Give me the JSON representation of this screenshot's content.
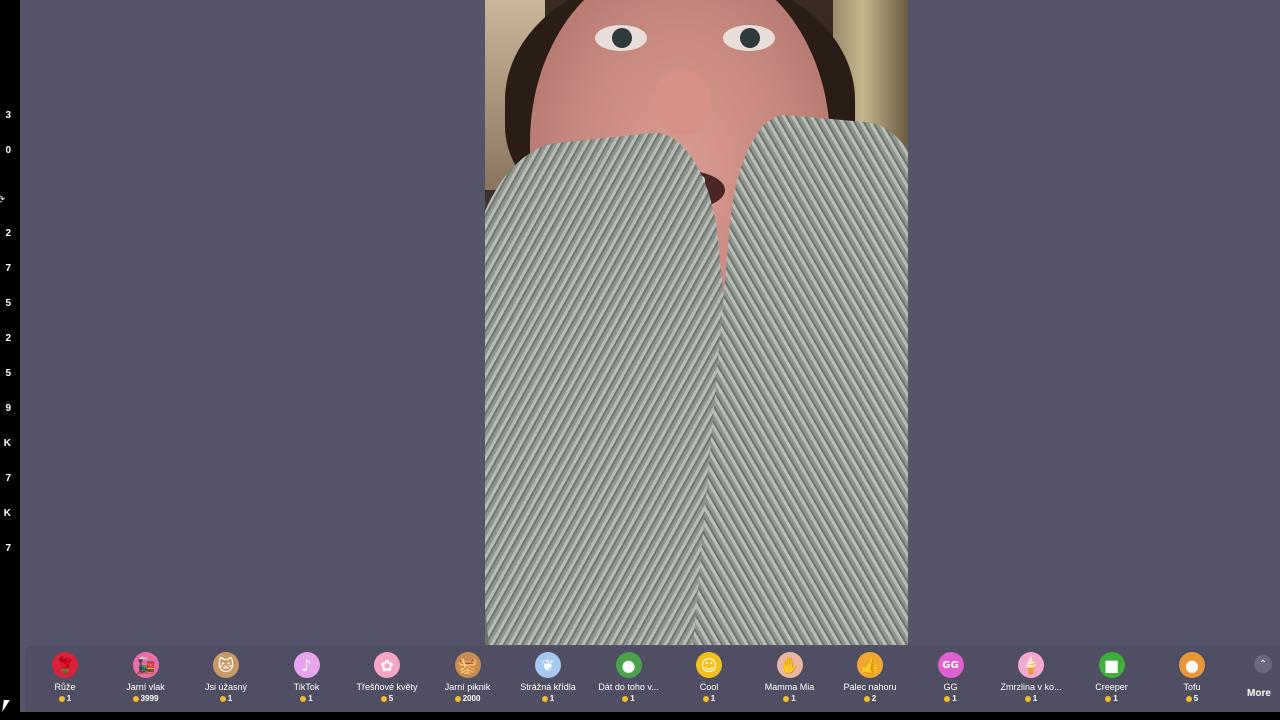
{
  "left_rail": {
    "numbers": [
      "3",
      "0",
      "2",
      "7",
      "5",
      "2",
      "5",
      "9",
      "K",
      "7",
      "K",
      "7"
    ],
    "refresh_icon": "refresh-icon"
  },
  "gift_bar": {
    "gifts": [
      {
        "name": "Růže",
        "price": "1",
        "icon": "rose-icon",
        "color": "#d8213a"
      },
      {
        "name": "Jarní vlak",
        "price": "3999",
        "icon": "spring-train-icon",
        "color": "#f06aa9"
      },
      {
        "name": "Jsi úžasný",
        "price": "1",
        "icon": "cat-icon",
        "color": "#c99a66"
      },
      {
        "name": "TikTok",
        "price": "1",
        "icon": "tiktok-icon",
        "color": "#e8a5ef"
      },
      {
        "name": "Třešňové květy",
        "price": "5",
        "icon": "cherry-blossom-icon",
        "color": "#f4a6c7"
      },
      {
        "name": "Jarní piknik",
        "price": "2000",
        "icon": "picnic-icon",
        "color": "#c58d54"
      },
      {
        "name": "Strážná křídla",
        "price": "1",
        "icon": "wings-icon",
        "color": "#a7c8f0"
      },
      {
        "name": "Dát do toho v...",
        "price": "1",
        "icon": "medal-icon",
        "color": "#4aa34a"
      },
      {
        "name": "Cool",
        "price": "1",
        "icon": "sunglasses-face-icon",
        "color": "#f2c01e"
      },
      {
        "name": "Mamma Mia",
        "price": "1",
        "icon": "hand-gesture-icon",
        "color": "#e9b7a0"
      },
      {
        "name": "Palec nahoru",
        "price": "2",
        "icon": "thumbs-up-icon",
        "color": "#f0a833"
      },
      {
        "name": "GG",
        "price": "1",
        "icon": "gg-icon",
        "color": "#e05fd2"
      },
      {
        "name": "Zmrzlina v ko...",
        "price": "1",
        "icon": "ice-cream-icon",
        "color": "#f3a9cf"
      },
      {
        "name": "Creeper",
        "price": "1",
        "icon": "creeper-icon",
        "color": "#3fae3a"
      },
      {
        "name": "Tofu",
        "price": "5",
        "icon": "tofu-icon",
        "color": "#e8963a"
      }
    ],
    "more_label": "More"
  }
}
